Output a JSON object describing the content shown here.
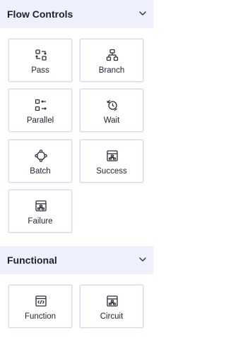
{
  "sections": [
    {
      "title": "Flow Controls",
      "chevron_icon": "chevron-down-icon",
      "items": [
        {
          "label": "Pass",
          "icon": "pass-icon"
        },
        {
          "label": "Branch",
          "icon": "branch-icon"
        },
        {
          "label": "Parallel",
          "icon": "parallel-icon"
        },
        {
          "label": "Wait",
          "icon": "wait-icon"
        },
        {
          "label": "Batch",
          "icon": "batch-icon"
        },
        {
          "label": "Success",
          "icon": "success-icon"
        },
        {
          "label": "Failure",
          "icon": "failure-icon"
        }
      ]
    },
    {
      "title": "Functional",
      "chevron_icon": "chevron-down-icon",
      "items": [
        {
          "label": "Function",
          "icon": "function-icon"
        },
        {
          "label": "Circuit",
          "icon": "circuit-icon"
        }
      ]
    }
  ],
  "colors": {
    "header_bg": "#eef0fb",
    "tile_border": "#d9dcf0",
    "text": "#1d2130"
  }
}
